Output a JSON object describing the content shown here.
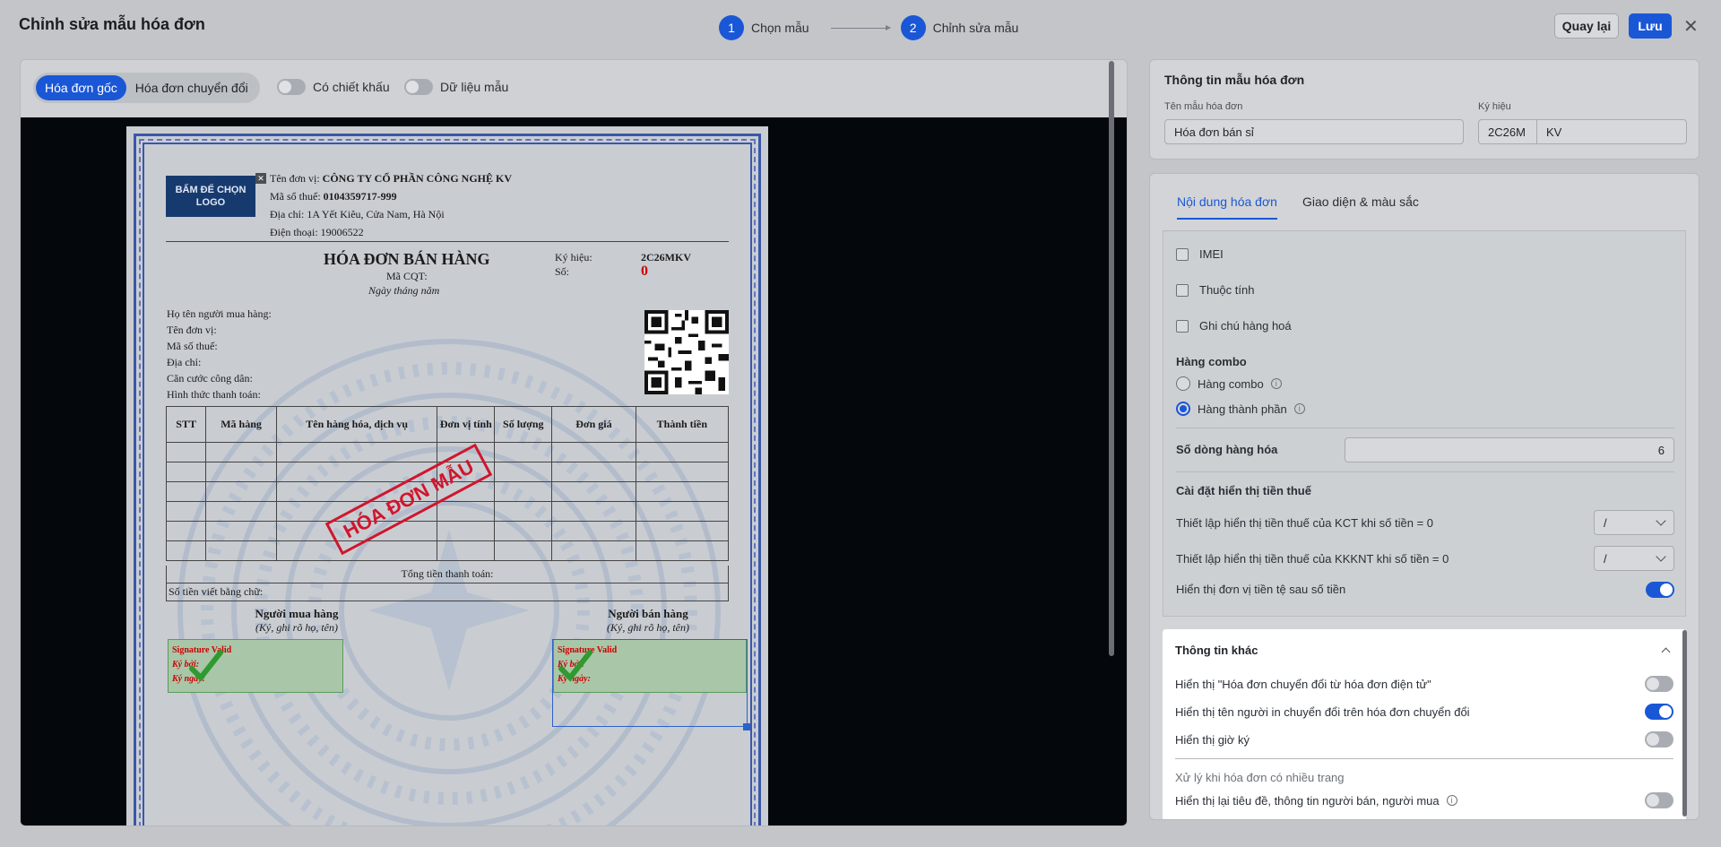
{
  "header": {
    "title": "Chỉnh sửa mẫu hóa đơn",
    "steps": [
      {
        "num": "1",
        "label": "Chọn mẫu"
      },
      {
        "num": "2",
        "label": "Chỉnh sửa mẫu"
      }
    ],
    "back_label": "Quay lại",
    "save_label": "Lưu"
  },
  "preview_toolbar": {
    "tabs": [
      "Hóa đơn gốc",
      "Hóa đơn chuyển đổi"
    ],
    "active_tab": "Hóa đơn gốc",
    "discount_label": "Có chiết khấu",
    "discount_on": false,
    "sample_label": "Dữ liệu mẫu",
    "sample_on": false
  },
  "invoice": {
    "logo_text": "BẤM ĐỂ CHỌN LOGO",
    "unit_label": "Tên đơn vị:",
    "unit_value": "CÔNG TY CỔ PHẦN CÔNG NGHỆ KV",
    "tax_label": "Mã số thuế:",
    "tax_value": "0104359717-999",
    "address": "Địa chỉ: 1A Yết Kiêu, Cửa Nam, Hà Nội",
    "phone": "Điện thoại: 19006522",
    "title": "HÓA ĐƠN BÁN HÀNG",
    "cqt": "Mã CQT:",
    "date": "Ngày tháng năm",
    "symbol_label": "Ký hiệu:",
    "symbol_value": "2C26MKV",
    "number_label": "Số:",
    "number_value": "0",
    "buyer_fields": [
      "Họ tên người mua hàng:",
      "Tên đơn vị:",
      "Mã số thuế:",
      "Địa chỉ:",
      "Căn cước công dân:",
      "Hình thức thanh toán:"
    ],
    "columns": [
      "STT",
      "Mã hàng",
      "Tên hàng hóa, dịch vụ",
      "Đơn vị tính",
      "Số lượng",
      "Đơn giá",
      "Thành tiền"
    ],
    "total_label": "Tổng tiền thanh toán:",
    "words_label": "Số tiền viết bằng chữ:",
    "buyer_sign": "Người mua hàng",
    "seller_sign": "Người bán hàng",
    "sign_note": "(Ký, ghi rõ họ, tên)",
    "sig_valid": "Signature Valid",
    "sig_by": "Ký bởi:",
    "sig_date": "Ký ngày:",
    "stamp": "HÓA ĐƠN MẪU"
  },
  "template_info": {
    "title": "Thông tin mẫu hóa đơn",
    "name_label": "Tên mẫu hóa đơn",
    "name_value": "Hóa đơn bán sỉ",
    "symbol_label": "Ký hiệu",
    "symbol_prefix": "2C26M",
    "symbol_value": "KV"
  },
  "settings": {
    "tabs": [
      "Nội dung hóa đơn",
      "Giao diện & màu sắc"
    ],
    "checkboxes": [
      "IMEI",
      "Thuộc tính",
      "Ghi chú hàng hoá"
    ],
    "combo_title": "Hàng combo",
    "combo_options": [
      "Hàng combo",
      "Hàng thành phần"
    ],
    "combo_selected": "Hàng thành phần",
    "rows_label": "Số dòng hàng hóa",
    "rows_value": "6",
    "tax_title": "Cài đặt hiển thị tiền thuế",
    "tax_kct_label": "Thiết lập hiển thị tiền thuế của KCT khi số tiền = 0",
    "tax_kct_value": "/",
    "tax_kkknt_label": "Thiết lập hiển thị tiền thuế của KKKNT khi số tiền = 0",
    "tax_kkknt_value": "/",
    "currency_label": "Hiển thị đơn vị tiền tệ sau số tiền",
    "currency_on": true
  },
  "other_info": {
    "title": "Thông tin khác",
    "rows": [
      {
        "label": "Hiển thị \"Hóa đơn chuyển đổi từ hóa đơn điện tử\"",
        "on": false
      },
      {
        "label": "Hiển thị tên người in chuyển đổi trên hóa đơn chuyển đổi",
        "on": true
      },
      {
        "label": "Hiển thị giờ ký",
        "on": false
      }
    ],
    "multipage_title": "Xử lý khi hóa đơn có nhiều trang",
    "multipage_label": "Hiển thị lại tiêu đề, thông tin người bán, người mua",
    "multipage_on": false
  }
}
